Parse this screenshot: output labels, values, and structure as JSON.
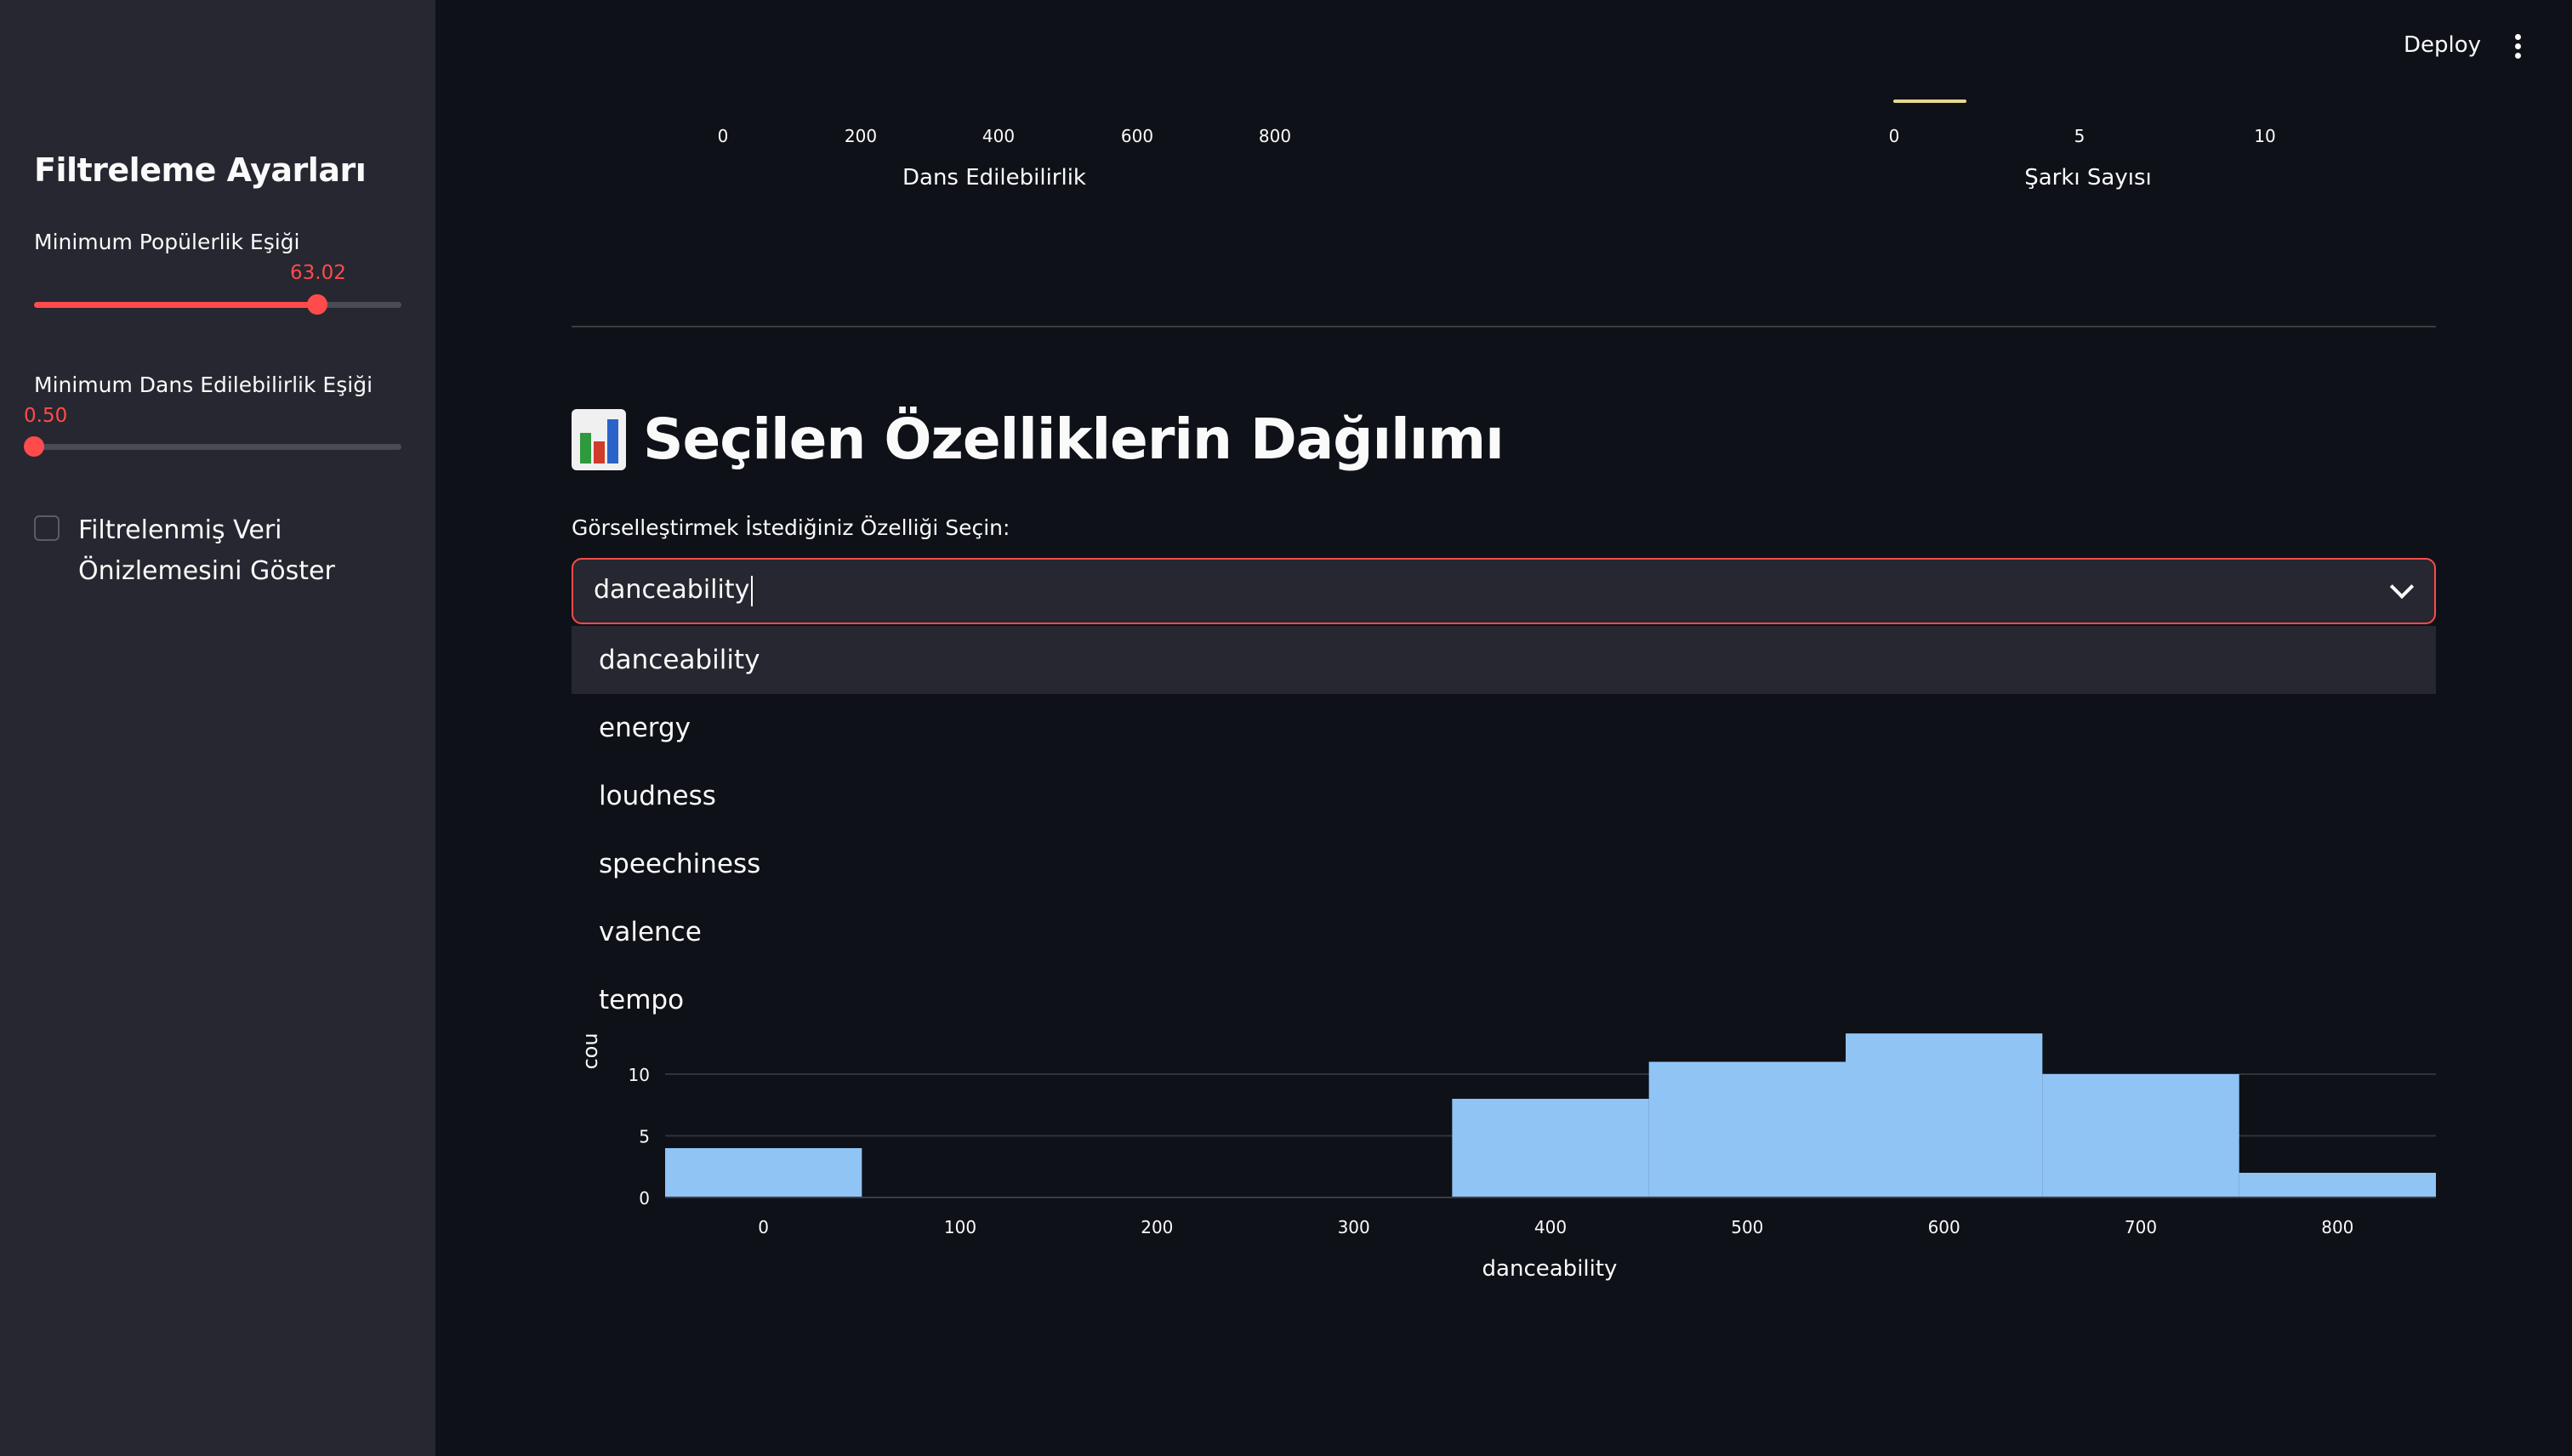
{
  "sidebar": {
    "title": "Filtreleme Ayarları",
    "popularity": {
      "label": "Minimum Popülerlik Eşiği",
      "value": "63.02",
      "fraction": 0.77
    },
    "danceability": {
      "label": "Minimum Dans Edilebilirlik Eşiği",
      "value": "0.50",
      "fraction": 0.0
    },
    "checkbox_label": "Filtrelenmiş Veri Önizlemesini Göster"
  },
  "header": {
    "deploy": "Deploy"
  },
  "top_charts": {
    "left": {
      "ticks": [
        "0",
        "200",
        "400",
        "600",
        "800"
      ],
      "axis_title": "Dans Edilebilirlik"
    },
    "right": {
      "ticks": [
        "0",
        "5",
        "10"
      ],
      "axis_title": "Şarkı Sayısı"
    }
  },
  "section": {
    "title": "Seçilen Özelliklerin Dağılımı",
    "select_label": "Görselleştirmek İstediğiniz Özelliği Seçin:",
    "select_value": "danceability",
    "options": [
      "danceability",
      "energy",
      "loudness",
      "speechiness",
      "valence",
      "tempo"
    ]
  },
  "colors": {
    "accent": "#ff4b4b",
    "bar": "#90c4f5",
    "sidebar": "#262730",
    "background": "#0e1117"
  },
  "chart_data": {
    "type": "bar",
    "xlabel": "danceability",
    "ylabel": "cou",
    "bins": [
      {
        "start": -50,
        "end": 50,
        "count": 4
      },
      {
        "start": 350,
        "end": 450,
        "count": 8
      },
      {
        "start": 450,
        "end": 550,
        "count": 11
      },
      {
        "start": 550,
        "end": 650,
        "count": 13.3
      },
      {
        "start": 650,
        "end": 750,
        "count": 10
      },
      {
        "start": 750,
        "end": 850,
        "count": 2
      }
    ],
    "x_ticks": [
      0,
      100,
      200,
      300,
      400,
      500,
      600,
      700,
      800
    ],
    "y_ticks": [
      0,
      5,
      10
    ],
    "xlim": [
      -50,
      850
    ]
  }
}
